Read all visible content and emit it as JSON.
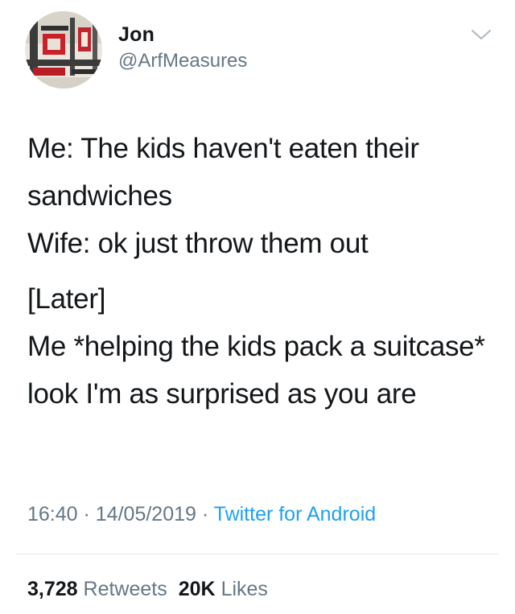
{
  "user": {
    "display_name": "Jon",
    "handle": "@ArfMeasures",
    "avatar_icon": "avatar-photo"
  },
  "menu": {
    "icon": "chevron-down-icon"
  },
  "tweet": {
    "lines": [
      "Me: The kids haven't eaten their sandwiches",
      "Wife: ok just throw them out",
      "[Later]",
      "Me *helping the kids pack a suitcase* look I'm as surprised as you are"
    ]
  },
  "meta": {
    "time": "16:40",
    "separator": " · ",
    "date": "14/05/2019",
    "source": "Twitter for Android"
  },
  "stats": {
    "retweets_count": "3,728",
    "retweets_label": "Retweets",
    "likes_count": "20K",
    "likes_label": "Likes"
  },
  "colors": {
    "text": "#14171a",
    "secondary": "#657786",
    "link": "#1da1f2",
    "divider": "#e1e8ed"
  }
}
